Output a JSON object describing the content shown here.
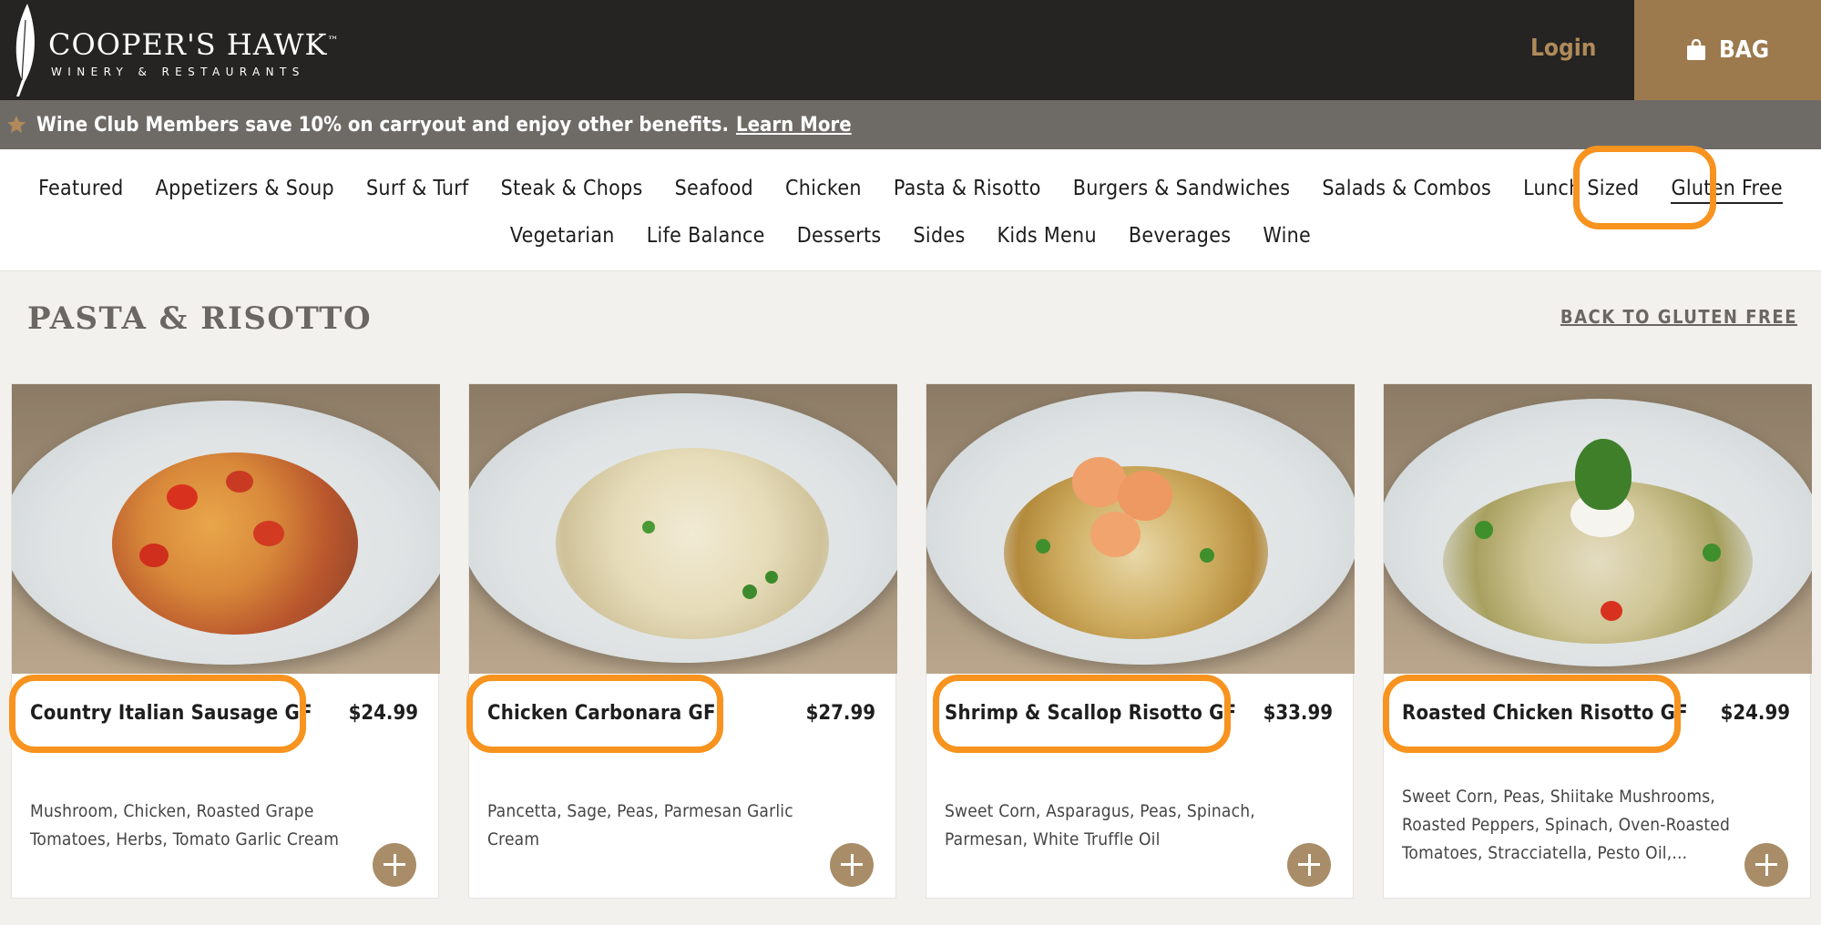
{
  "header": {
    "logo_name": "COOPER'S HAWK",
    "logo_tm": "™",
    "logo_sub": "WINERY & RESTAURANTS",
    "login_label": "Login",
    "bag_label": "BAG"
  },
  "promo": {
    "text": "Wine Club Members save 10% on carryout and enjoy other benefits.",
    "link_label": "Learn More"
  },
  "nav": {
    "row1": [
      "Featured",
      "Appetizers & Soup",
      "Surf & Turf",
      "Steak & Chops",
      "Seafood",
      "Chicken",
      "Pasta & Risotto",
      "Burgers & Sandwiches",
      "Salads & Combos",
      "Lunch Sized",
      "Gluten Free"
    ],
    "row2": [
      "Vegetarian",
      "Life Balance",
      "Desserts",
      "Sides",
      "Kids Menu",
      "Beverages",
      "Wine"
    ],
    "active": "Gluten Free"
  },
  "section": {
    "title": "PASTA & RISOTTO",
    "back_label": "BACK TO GLUTEN FREE"
  },
  "items": [
    {
      "title": "Country Italian Sausage GF",
      "price": "$24.99",
      "description": "Mushroom, Chicken, Roasted Grape Tomatoes, Herbs, Tomato Garlic Cream"
    },
    {
      "title": "Chicken Carbonara GF",
      "price": "$27.99",
      "description": "Pancetta, Sage, Peas, Parmesan Garlic Cream"
    },
    {
      "title": "Shrimp & Scallop Risotto GF",
      "price": "$33.99",
      "description": "Sweet Corn, Asparagus, Peas, Spinach, Parmesan, White Truffle Oil"
    },
    {
      "title": "Roasted Chicken Risotto GF",
      "price": "$24.99",
      "description": "Sweet Corn, Peas, Shiitake Mushrooms, Roasted Peppers, Spinach, Oven-Roasted Tomatoes, Stracciatella, Pesto Oil,..."
    }
  ],
  "colors": {
    "header_bg": "#252423",
    "bag_bg": "#9c7a4e",
    "promo_bg": "#6e6b67",
    "highlight": "#f7931e",
    "add_button": "#a98d68"
  },
  "icons": [
    "feather-logo-icon",
    "shopping-bag-icon",
    "star-icon",
    "plus-icon"
  ]
}
